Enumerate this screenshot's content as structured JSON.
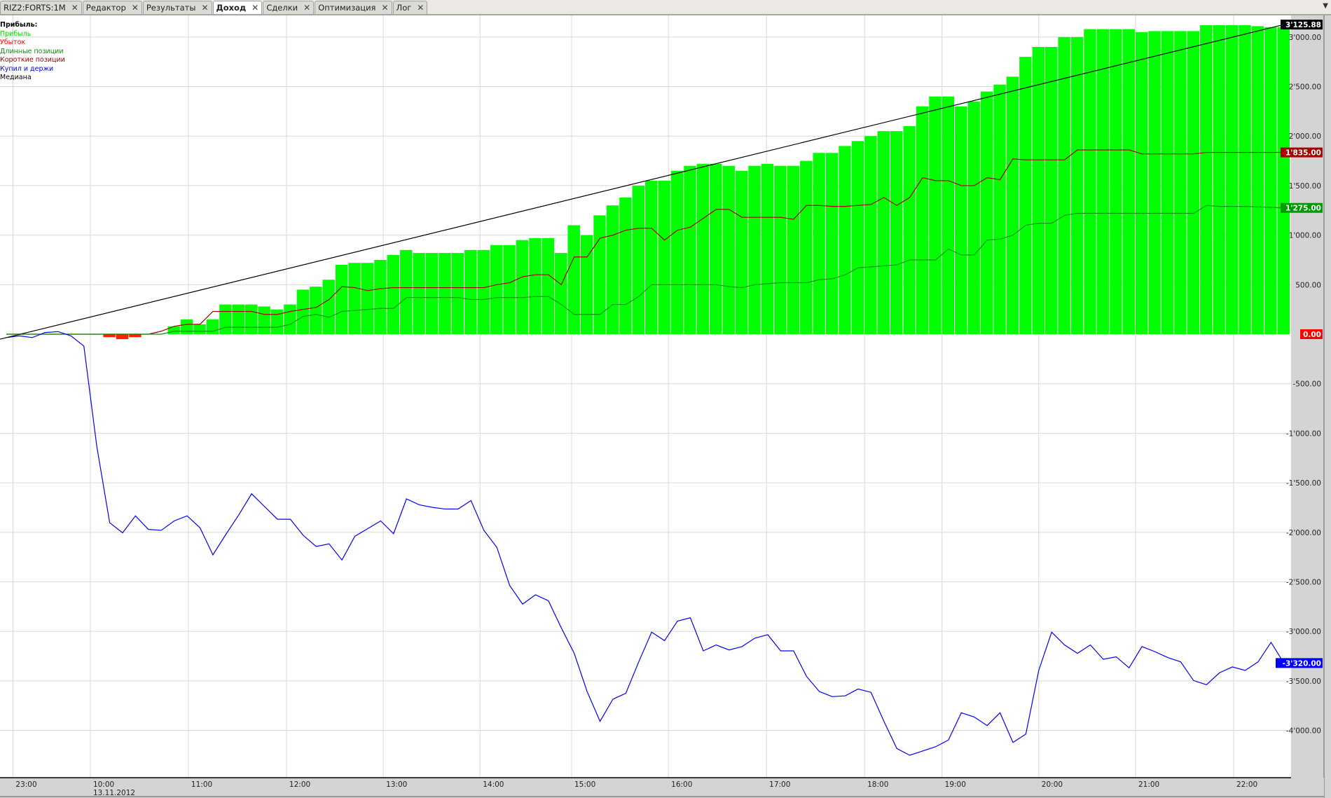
{
  "tabs": [
    {
      "label": "RIZ2:FORTS:1M",
      "active": false
    },
    {
      "label": "Редактор",
      "active": false
    },
    {
      "label": "Результаты",
      "active": false
    },
    {
      "label": "Доход",
      "active": true
    },
    {
      "label": "Сделки",
      "active": false
    },
    {
      "label": "Оптимизация",
      "active": false
    },
    {
      "label": "Лог",
      "active": false
    }
  ],
  "close_glyph": "✕",
  "menu_glyph": "▼",
  "legend": {
    "title": "Прибыль:",
    "items": [
      {
        "label": "Прибыль",
        "color": "#00e000"
      },
      {
        "label": "Убыток",
        "color": "#ff0000"
      },
      {
        "label": "Длинные позиции",
        "color": "#009900"
      },
      {
        "label": "Короткие позиции",
        "color": "#aa0000"
      },
      {
        "label": "Купил и держи",
        "color": "#0000ff"
      },
      {
        "label": "Медиана",
        "color": "#000000"
      }
    ]
  },
  "chart_data": {
    "type": "bar",
    "title": "Прибыль",
    "date_label": "13.11.2012",
    "x_ticks": [
      {
        "label": "23:00",
        "bar": 1
      },
      {
        "label": "10:00",
        "bar": 7
      },
      {
        "label": "11:00",
        "bar": 14.6
      },
      {
        "label": "12:00",
        "bar": 22.2
      },
      {
        "label": "13:00",
        "bar": 29.7
      },
      {
        "label": "14:00",
        "bar": 37.2
      },
      {
        "label": "15:00",
        "bar": 44.3
      },
      {
        "label": "16:00",
        "bar": 51.8
      },
      {
        "label": "17:00",
        "bar": 59.4
      },
      {
        "label": "18:00",
        "bar": 67
      },
      {
        "label": "19:00",
        "bar": 73
      },
      {
        "label": "20:00",
        "bar": 80.5
      },
      {
        "label": "21:00",
        "bar": 88
      },
      {
        "label": "22:00",
        "bar": 95.6
      }
    ],
    "y_ticks": [
      {
        "value": 3000,
        "label": "3'000.00"
      },
      {
        "value": 2500,
        "label": "2'500.00"
      },
      {
        "value": 2000,
        "label": "2'000.00"
      },
      {
        "value": 1500,
        "label": "1'500.00"
      },
      {
        "value": 1000,
        "label": "1'000.00"
      },
      {
        "value": 500,
        "label": "500.00"
      },
      {
        "value": -500,
        "label": "-500.00"
      },
      {
        "value": -1000,
        "label": "-1'000.00"
      },
      {
        "value": -1500,
        "label": "-1'500.00"
      },
      {
        "value": -2000,
        "label": "-2'000.00"
      },
      {
        "value": -2500,
        "label": "-2'500.00"
      },
      {
        "value": -3000,
        "label": "-3'000.00"
      },
      {
        "value": -3500,
        "label": "-3'500.00"
      },
      {
        "value": -4000,
        "label": "-4'000.00"
      }
    ],
    "ylim": [
      -4450,
      3200
    ],
    "value_badges": [
      {
        "value": 3125.88,
        "label": "3'125.88",
        "color": "#000000"
      },
      {
        "value": 1835,
        "label": "1'835.00",
        "color": "#aa0000"
      },
      {
        "value": 1275,
        "label": "1'275.00",
        "color": "#009900"
      },
      {
        "value": 0,
        "label": "0.00",
        "color": "#ff0000"
      },
      {
        "value": -3320,
        "label": "-3'320.00",
        "color": "#0000ff"
      }
    ],
    "profit": [
      0,
      0,
      0,
      0,
      0,
      0,
      0,
      0,
      -30,
      -50,
      -30,
      0,
      0,
      80,
      150,
      100,
      150,
      300,
      300,
      300,
      280,
      250,
      300,
      450,
      480,
      550,
      700,
      720,
      720,
      750,
      800,
      850,
      820,
      820,
      820,
      820,
      850,
      850,
      900,
      900,
      950,
      970,
      970,
      820,
      1100,
      1000,
      1200,
      1300,
      1380,
      1500,
      1550,
      1550,
      1650,
      1700,
      1720,
      1720,
      1700,
      1650,
      1700,
      1720,
      1700,
      1700,
      1750,
      1830,
      1830,
      1900,
      1950,
      2000,
      2050,
      2050,
      2100,
      2300,
      2400,
      2400,
      2300,
      2350,
      2450,
      2520,
      2600,
      2800,
      2900,
      2900,
      3000,
      3000,
      3080,
      3080,
      3080,
      3080,
      3050,
      3060,
      3060,
      3060,
      3060,
      3120,
      3120,
      3120,
      3120,
      3110,
      3100,
      3100
    ],
    "series": [
      {
        "name": "Короткие позиции",
        "color": "#aa0000",
        "values": [
          0,
          0,
          0,
          0,
          0,
          0,
          0,
          0,
          0,
          0,
          0,
          0,
          30,
          80,
          100,
          100,
          230,
          230,
          230,
          230,
          200,
          200,
          230,
          250,
          270,
          350,
          480,
          470,
          440,
          460,
          470,
          470,
          470,
          470,
          470,
          470,
          470,
          470,
          500,
          520,
          580,
          600,
          600,
          500,
          780,
          780,
          970,
          1000,
          1050,
          1070,
          1070,
          950,
          1050,
          1080,
          1170,
          1260,
          1260,
          1180,
          1180,
          1180,
          1180,
          1160,
          1300,
          1300,
          1290,
          1290,
          1300,
          1310,
          1380,
          1300,
          1380,
          1580,
          1550,
          1550,
          1500,
          1500,
          1580,
          1560,
          1770,
          1760,
          1760,
          1760,
          1760,
          1860,
          1860,
          1860,
          1860,
          1860,
          1820,
          1820,
          1820,
          1820,
          1820,
          1835,
          1835,
          1835,
          1835,
          1835,
          1835,
          1835
        ]
      },
      {
        "name": "Длинные позиции",
        "color": "#009900",
        "values": [
          0,
          0,
          0,
          0,
          0,
          0,
          0,
          0,
          0,
          0,
          0,
          0,
          0,
          30,
          30,
          30,
          30,
          70,
          70,
          70,
          70,
          70,
          100,
          180,
          200,
          170,
          230,
          240,
          250,
          260,
          260,
          370,
          370,
          370,
          370,
          370,
          350,
          350,
          370,
          370,
          370,
          380,
          380,
          300,
          200,
          200,
          200,
          300,
          300,
          380,
          500,
          500,
          500,
          500,
          500,
          500,
          480,
          470,
          500,
          510,
          520,
          520,
          520,
          550,
          560,
          600,
          670,
          680,
          690,
          700,
          750,
          750,
          750,
          860,
          800,
          800,
          950,
          960,
          1000,
          1100,
          1120,
          1120,
          1200,
          1220,
          1220,
          1220,
          1220,
          1220,
          1220,
          1220,
          1220,
          1220,
          1220,
          1300,
          1290,
          1290,
          1290,
          1285,
          1280,
          1275
        ]
      },
      {
        "name": "Купил и держи",
        "color": "#0000ff",
        "values": [
          -34,
          -17,
          -34,
          17,
          26,
          -17,
          -120,
          -1131,
          -1903,
          -2005,
          -1834,
          -1971,
          -1980,
          -1885,
          -1834,
          -1954,
          -2228,
          -2022,
          -1825,
          -1611,
          -1740,
          -1868,
          -1868,
          -2031,
          -2143,
          -2117,
          -2280,
          -2040,
          -1963,
          -1885,
          -2014,
          -1663,
          -1723,
          -1748,
          -1765,
          -1765,
          -1680,
          -1980,
          -2151,
          -2537,
          -2725,
          -2631,
          -2691,
          -2965,
          -3222,
          -3608,
          -3908,
          -3685,
          -3625,
          -3308,
          -3008,
          -3094,
          -2897,
          -2863,
          -3197,
          -3137,
          -3188,
          -3154,
          -3068,
          -3034,
          -3197,
          -3197,
          -3454,
          -3608,
          -3659,
          -3651,
          -3582,
          -3616,
          -3908,
          -4182,
          -4251,
          -4208,
          -4165,
          -4097,
          -3822,
          -3865,
          -3951,
          -3822,
          -4122,
          -4037,
          -3394,
          -3008,
          -3137,
          -3222,
          -3137,
          -3282,
          -3257,
          -3368,
          -3154,
          -3205,
          -3265,
          -3308,
          -3497,
          -3539,
          -3419,
          -3359,
          -3394,
          -3308,
          -3111,
          -3320
        ]
      },
      {
        "name": "Медиана",
        "color": "#000000",
        "values": [
          -50,
          3125.88
        ]
      }
    ]
  }
}
